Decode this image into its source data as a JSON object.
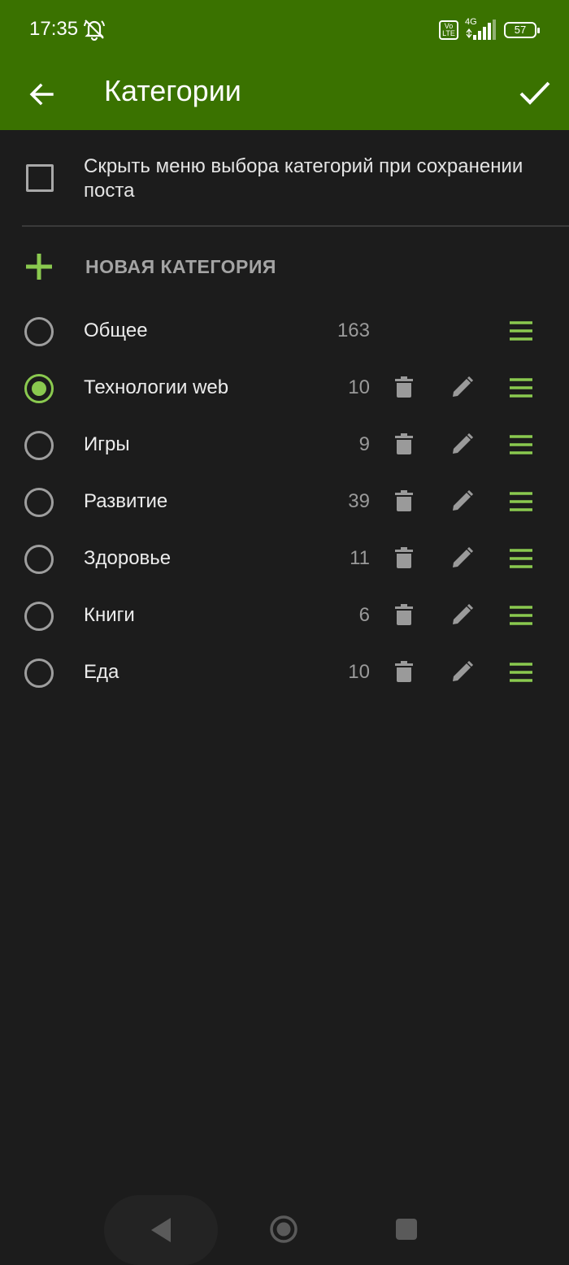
{
  "status_bar": {
    "time": "17:35",
    "volte": "Vo\nLTE",
    "network": "4G",
    "battery": "57"
  },
  "app_bar": {
    "title": "Категории",
    "back_icon": "arrow-left-icon",
    "confirm_icon": "check-icon"
  },
  "hide_menu": {
    "label": "Скрыть меню выбора категорий при сохранении поста",
    "checked": false
  },
  "new_category": {
    "label": "НОВАЯ КАТЕГОРИЯ"
  },
  "categories": [
    {
      "name": "Общее",
      "count": "163",
      "selected": false,
      "editable": false
    },
    {
      "name": "Технологии web",
      "count": "10",
      "selected": true,
      "editable": true
    },
    {
      "name": "Игры",
      "count": "9",
      "selected": false,
      "editable": true
    },
    {
      "name": "Развитие",
      "count": "39",
      "selected": false,
      "editable": true
    },
    {
      "name": "Здоровье",
      "count": "11",
      "selected": false,
      "editable": true
    },
    {
      "name": "Книги",
      "count": "6",
      "selected": false,
      "editable": true
    },
    {
      "name": "Еда",
      "count": "10",
      "selected": false,
      "editable": true
    }
  ],
  "colors": {
    "accent": "#3a7200",
    "highlight": "#8ac94f",
    "background": "#1c1c1c"
  }
}
